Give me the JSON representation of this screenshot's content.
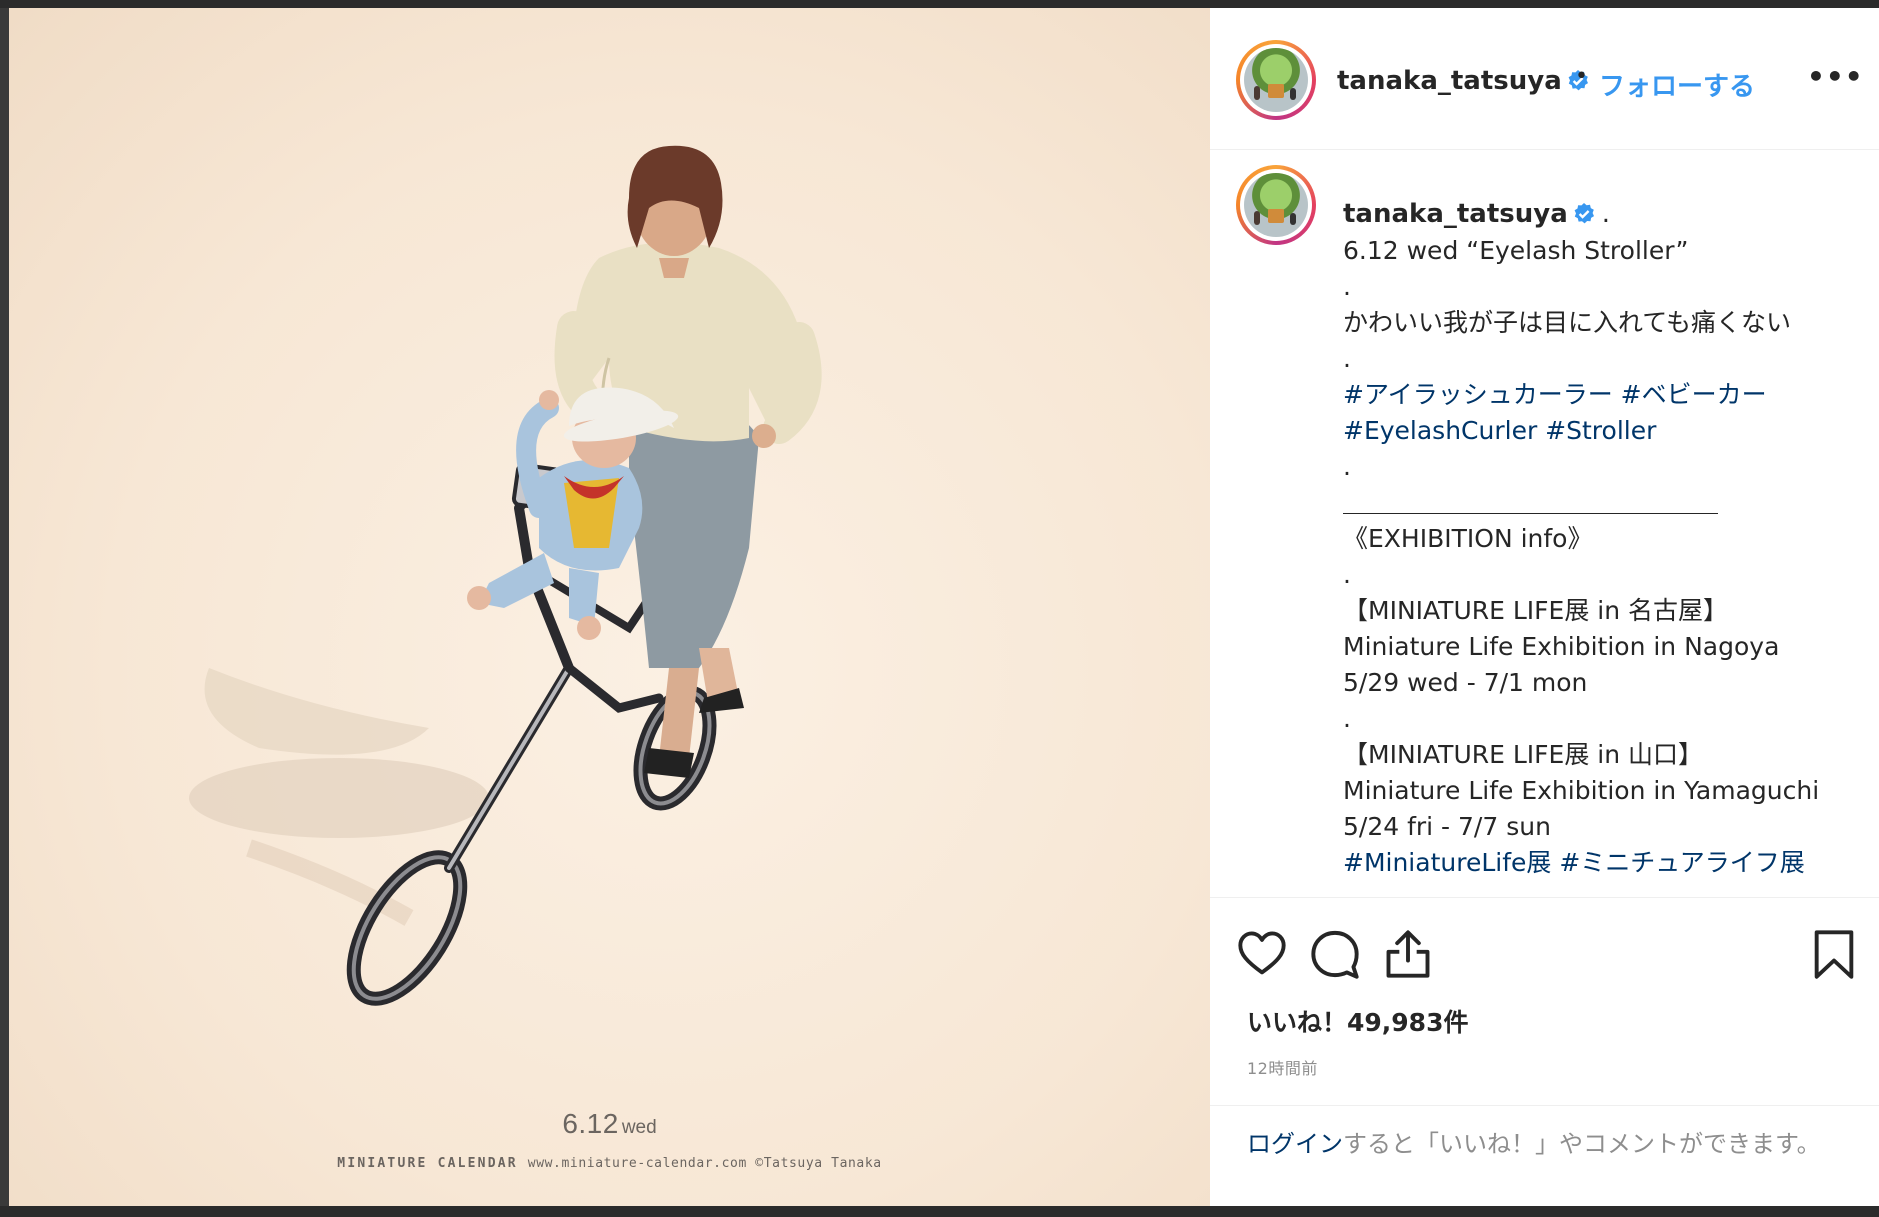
{
  "post": {
    "username": "tanaka_tatsuya",
    "follow_label": "フォローする",
    "separator": "•",
    "more_label": "•••",
    "caption": {
      "username": "tanaka_tatsuya",
      "trailing": ".",
      "lines": [
        {
          "text": "6.12 wed “Eyelash Stroller”",
          "kind": "text"
        },
        {
          "text": ".",
          "kind": "text"
        },
        {
          "text": "かわいい我が子は目に入れても痛くない",
          "kind": "text"
        },
        {
          "text": ".",
          "kind": "text"
        },
        {
          "text": "#アイラッシュカーラー #ベビーカー",
          "kind": "tag"
        },
        {
          "text": "#EyelashCurler #Stroller",
          "kind": "tag"
        },
        {
          "text": ".",
          "kind": "text"
        },
        {
          "text": "＿＿＿＿＿＿＿＿＿＿＿＿＿＿＿",
          "kind": "text"
        },
        {
          "text": "《EXHIBITION info》",
          "kind": "text"
        },
        {
          "text": ".",
          "kind": "text"
        },
        {
          "text": "【MINIATURE LIFE展 in 名古屋】",
          "kind": "text"
        },
        {
          "text": "Miniature Life Exhibition in Nagoya",
          "kind": "text"
        },
        {
          "text": "5/29 wed - 7/1 mon",
          "kind": "text"
        },
        {
          "text": ".",
          "kind": "text"
        },
        {
          "text": "【MINIATURE LIFE展 in 山口】",
          "kind": "text"
        },
        {
          "text": "Miniature Life Exhibition in Yamaguchi",
          "kind": "text"
        },
        {
          "text": "5/24 fri - 7/7 sun",
          "kind": "text"
        },
        {
          "text": "#MiniatureLife展 #ミニチュアライフ展",
          "kind": "tag"
        }
      ]
    },
    "likes_label": "いいね！49,983件",
    "likes_count": 49983,
    "timestamp": "12時間前",
    "login_link": "ログイン",
    "login_rest": "すると「いいね！」やコメントができます。"
  },
  "photo": {
    "calendar_date": "6.12",
    "calendar_weekday": "wed",
    "calendar_brand": "MINIATURE CALENDAR",
    "calendar_credit": "www.miniature-calendar.com ©Tatsuya Tanaka"
  },
  "icons": {
    "like": "heart-icon",
    "comment": "comment-icon",
    "share": "share-icon",
    "save": "bookmark-icon",
    "verified": "verified-badge-icon"
  },
  "colors": {
    "link_blue": "#3897f0",
    "hashtag": "#003569",
    "verified": "#3897f0",
    "muted": "#8e8e8e"
  }
}
